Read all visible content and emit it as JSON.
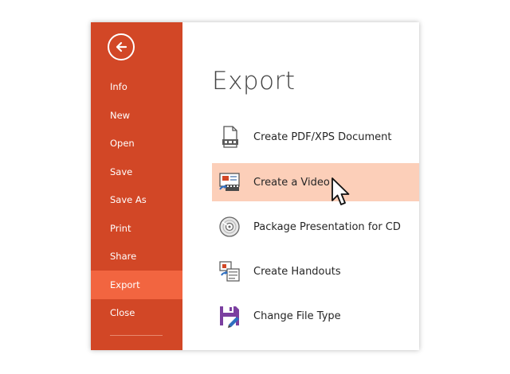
{
  "sidebar": {
    "back_icon": "back-arrow-icon",
    "items": [
      {
        "label": "Info"
      },
      {
        "label": "New"
      },
      {
        "label": "Open"
      },
      {
        "label": "Save"
      },
      {
        "label": "Save As"
      },
      {
        "label": "Print"
      },
      {
        "label": "Share"
      },
      {
        "label": "Export",
        "active": true
      },
      {
        "label": "Close"
      }
    ]
  },
  "main": {
    "title": "Export",
    "options": [
      {
        "label": "Create PDF/XPS Document",
        "icon": "pdf-document-icon"
      },
      {
        "label": "Create a Video",
        "icon": "video-icon",
        "selected": true
      },
      {
        "label": "Package Presentation for CD",
        "icon": "cd-icon"
      },
      {
        "label": "Create Handouts",
        "icon": "handouts-icon"
      },
      {
        "label": "Change File Type",
        "icon": "save-file-icon"
      }
    ]
  },
  "colors": {
    "sidebar_bg": "#d24726",
    "active_item_bg": "#f26540",
    "selected_option_bg": "#fccfb9"
  }
}
